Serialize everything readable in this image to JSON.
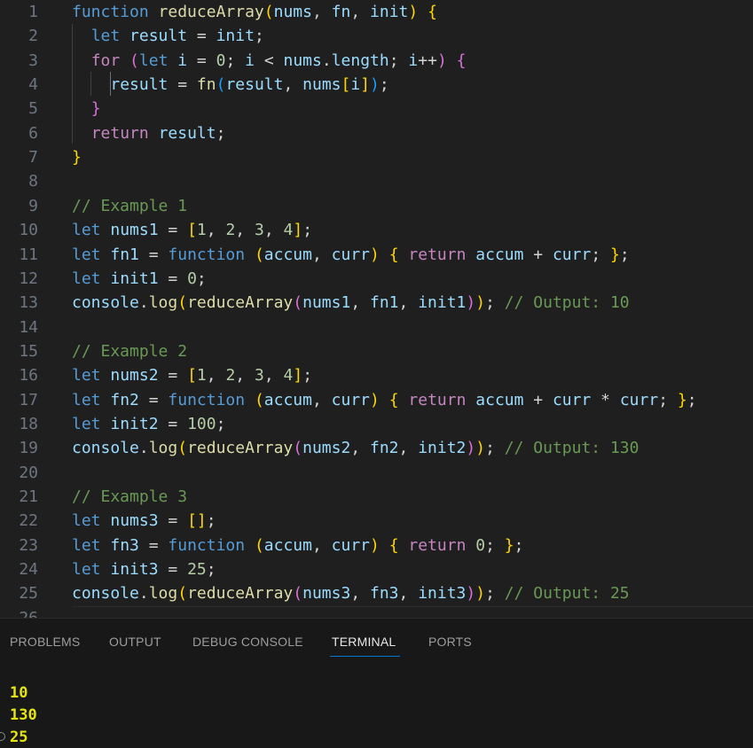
{
  "editor": {
    "lines": [
      {
        "num": "1",
        "tokens": [
          [
            "function",
            "#569cd6"
          ],
          [
            " ",
            "#cccccc"
          ],
          [
            "reduceArray",
            "#dcdcaa"
          ],
          [
            "(",
            "#ffd700"
          ],
          [
            "nums",
            "#9cdcfe"
          ],
          [
            ", ",
            "#cccccc"
          ],
          [
            "fn",
            "#9cdcfe"
          ],
          [
            ", ",
            "#cccccc"
          ],
          [
            "init",
            "#9cdcfe"
          ],
          [
            ")",
            "#ffd700"
          ],
          [
            " ",
            "#cccccc"
          ],
          [
            "{",
            "#ffd700"
          ]
        ]
      },
      {
        "num": "2",
        "tokens": [
          [
            "  ",
            "#cccccc"
          ],
          [
            "let",
            "#569cd6"
          ],
          [
            " ",
            "#cccccc"
          ],
          [
            "result",
            "#9cdcfe"
          ],
          [
            " = ",
            "#d4d4d4"
          ],
          [
            "init",
            "#9cdcfe"
          ],
          [
            ";",
            "#d4d4d4"
          ]
        ]
      },
      {
        "num": "3",
        "tokens": [
          [
            "  ",
            "#cccccc"
          ],
          [
            "for",
            "#c586c0"
          ],
          [
            " ",
            "#cccccc"
          ],
          [
            "(",
            "#da70d6"
          ],
          [
            "let",
            "#569cd6"
          ],
          [
            " ",
            "#cccccc"
          ],
          [
            "i",
            "#9cdcfe"
          ],
          [
            " = ",
            "#d4d4d4"
          ],
          [
            "0",
            "#b5cea8"
          ],
          [
            "; ",
            "#d4d4d4"
          ],
          [
            "i",
            "#9cdcfe"
          ],
          [
            " < ",
            "#d4d4d4"
          ],
          [
            "nums",
            "#9cdcfe"
          ],
          [
            ".",
            "#d4d4d4"
          ],
          [
            "length",
            "#9cdcfe"
          ],
          [
            "; ",
            "#d4d4d4"
          ],
          [
            "i",
            "#9cdcfe"
          ],
          [
            "++",
            "#d4d4d4"
          ],
          [
            ")",
            "#da70d6"
          ],
          [
            " ",
            "#cccccc"
          ],
          [
            "{",
            "#da70d6"
          ]
        ]
      },
      {
        "num": "4",
        "tokens": [
          [
            "    ",
            "#cccccc"
          ],
          [
            "result",
            "#9cdcfe"
          ],
          [
            " = ",
            "#d4d4d4"
          ],
          [
            "fn",
            "#dcdcaa"
          ],
          [
            "(",
            "#179fff"
          ],
          [
            "result",
            "#9cdcfe"
          ],
          [
            ", ",
            "#d4d4d4"
          ],
          [
            "nums",
            "#9cdcfe"
          ],
          [
            "[",
            "#ffd700"
          ],
          [
            "i",
            "#9cdcfe"
          ],
          [
            "]",
            "#ffd700"
          ],
          [
            ")",
            "#179fff"
          ],
          [
            ";",
            "#d4d4d4"
          ]
        ]
      },
      {
        "num": "5",
        "tokens": [
          [
            "  ",
            "#cccccc"
          ],
          [
            "}",
            "#da70d6"
          ]
        ]
      },
      {
        "num": "6",
        "tokens": [
          [
            "  ",
            "#cccccc"
          ],
          [
            "return",
            "#c586c0"
          ],
          [
            " ",
            "#cccccc"
          ],
          [
            "result",
            "#9cdcfe"
          ],
          [
            ";",
            "#d4d4d4"
          ]
        ]
      },
      {
        "num": "7",
        "tokens": [
          [
            "}",
            "#ffd700"
          ]
        ]
      },
      {
        "num": "8",
        "tokens": []
      },
      {
        "num": "9",
        "tokens": [
          [
            "// Example 1",
            "#6a9955"
          ]
        ]
      },
      {
        "num": "10",
        "tokens": [
          [
            "let",
            "#569cd6"
          ],
          [
            " ",
            "#cccccc"
          ],
          [
            "nums1",
            "#9cdcfe"
          ],
          [
            " = ",
            "#d4d4d4"
          ],
          [
            "[",
            "#ffd700"
          ],
          [
            "1",
            "#b5cea8"
          ],
          [
            ", ",
            "#d4d4d4"
          ],
          [
            "2",
            "#b5cea8"
          ],
          [
            ", ",
            "#d4d4d4"
          ],
          [
            "3",
            "#b5cea8"
          ],
          [
            ", ",
            "#d4d4d4"
          ],
          [
            "4",
            "#b5cea8"
          ],
          [
            "]",
            "#ffd700"
          ],
          [
            ";",
            "#d4d4d4"
          ]
        ]
      },
      {
        "num": "11",
        "tokens": [
          [
            "let",
            "#569cd6"
          ],
          [
            " ",
            "#cccccc"
          ],
          [
            "fn1",
            "#9cdcfe"
          ],
          [
            " = ",
            "#d4d4d4"
          ],
          [
            "function",
            "#569cd6"
          ],
          [
            " ",
            "#cccccc"
          ],
          [
            "(",
            "#ffd700"
          ],
          [
            "accum",
            "#9cdcfe"
          ],
          [
            ", ",
            "#d4d4d4"
          ],
          [
            "curr",
            "#9cdcfe"
          ],
          [
            ")",
            "#ffd700"
          ],
          [
            " ",
            "#cccccc"
          ],
          [
            "{",
            "#ffd700"
          ],
          [
            " ",
            "#cccccc"
          ],
          [
            "return",
            "#c586c0"
          ],
          [
            " ",
            "#cccccc"
          ],
          [
            "accum",
            "#9cdcfe"
          ],
          [
            " + ",
            "#d4d4d4"
          ],
          [
            "curr",
            "#9cdcfe"
          ],
          [
            "; ",
            "#d4d4d4"
          ],
          [
            "}",
            "#ffd700"
          ],
          [
            ";",
            "#d4d4d4"
          ]
        ]
      },
      {
        "num": "12",
        "tokens": [
          [
            "let",
            "#569cd6"
          ],
          [
            " ",
            "#cccccc"
          ],
          [
            "init1",
            "#9cdcfe"
          ],
          [
            " = ",
            "#d4d4d4"
          ],
          [
            "0",
            "#b5cea8"
          ],
          [
            ";",
            "#d4d4d4"
          ]
        ]
      },
      {
        "num": "13",
        "tokens": [
          [
            "console",
            "#9cdcfe"
          ],
          [
            ".",
            "#d4d4d4"
          ],
          [
            "log",
            "#dcdcaa"
          ],
          [
            "(",
            "#ffd700"
          ],
          [
            "reduceArray",
            "#dcdcaa"
          ],
          [
            "(",
            "#da70d6"
          ],
          [
            "nums1",
            "#9cdcfe"
          ],
          [
            ", ",
            "#d4d4d4"
          ],
          [
            "fn1",
            "#9cdcfe"
          ],
          [
            ", ",
            "#d4d4d4"
          ],
          [
            "init1",
            "#9cdcfe"
          ],
          [
            ")",
            "#da70d6"
          ],
          [
            ")",
            "#ffd700"
          ],
          [
            ";",
            "#d4d4d4"
          ],
          [
            " ",
            "#cccccc"
          ],
          [
            "// Output: 10",
            "#6a9955"
          ]
        ]
      },
      {
        "num": "14",
        "tokens": []
      },
      {
        "num": "15",
        "tokens": [
          [
            "// Example 2",
            "#6a9955"
          ]
        ]
      },
      {
        "num": "16",
        "tokens": [
          [
            "let",
            "#569cd6"
          ],
          [
            " ",
            "#cccccc"
          ],
          [
            "nums2",
            "#9cdcfe"
          ],
          [
            " = ",
            "#d4d4d4"
          ],
          [
            "[",
            "#ffd700"
          ],
          [
            "1",
            "#b5cea8"
          ],
          [
            ", ",
            "#d4d4d4"
          ],
          [
            "2",
            "#b5cea8"
          ],
          [
            ", ",
            "#d4d4d4"
          ],
          [
            "3",
            "#b5cea8"
          ],
          [
            ", ",
            "#d4d4d4"
          ],
          [
            "4",
            "#b5cea8"
          ],
          [
            "]",
            "#ffd700"
          ],
          [
            ";",
            "#d4d4d4"
          ]
        ]
      },
      {
        "num": "17",
        "tokens": [
          [
            "let",
            "#569cd6"
          ],
          [
            " ",
            "#cccccc"
          ],
          [
            "fn2",
            "#9cdcfe"
          ],
          [
            " = ",
            "#d4d4d4"
          ],
          [
            "function",
            "#569cd6"
          ],
          [
            " ",
            "#cccccc"
          ],
          [
            "(",
            "#ffd700"
          ],
          [
            "accum",
            "#9cdcfe"
          ],
          [
            ", ",
            "#d4d4d4"
          ],
          [
            "curr",
            "#9cdcfe"
          ],
          [
            ")",
            "#ffd700"
          ],
          [
            " ",
            "#cccccc"
          ],
          [
            "{",
            "#ffd700"
          ],
          [
            " ",
            "#cccccc"
          ],
          [
            "return",
            "#c586c0"
          ],
          [
            " ",
            "#cccccc"
          ],
          [
            "accum",
            "#9cdcfe"
          ],
          [
            " + ",
            "#d4d4d4"
          ],
          [
            "curr",
            "#9cdcfe"
          ],
          [
            " * ",
            "#d4d4d4"
          ],
          [
            "curr",
            "#9cdcfe"
          ],
          [
            "; ",
            "#d4d4d4"
          ],
          [
            "}",
            "#ffd700"
          ],
          [
            ";",
            "#d4d4d4"
          ]
        ]
      },
      {
        "num": "18",
        "tokens": [
          [
            "let",
            "#569cd6"
          ],
          [
            " ",
            "#cccccc"
          ],
          [
            "init2",
            "#9cdcfe"
          ],
          [
            " = ",
            "#d4d4d4"
          ],
          [
            "100",
            "#b5cea8"
          ],
          [
            ";",
            "#d4d4d4"
          ]
        ]
      },
      {
        "num": "19",
        "tokens": [
          [
            "console",
            "#9cdcfe"
          ],
          [
            ".",
            "#d4d4d4"
          ],
          [
            "log",
            "#dcdcaa"
          ],
          [
            "(",
            "#ffd700"
          ],
          [
            "reduceArray",
            "#dcdcaa"
          ],
          [
            "(",
            "#da70d6"
          ],
          [
            "nums2",
            "#9cdcfe"
          ],
          [
            ", ",
            "#d4d4d4"
          ],
          [
            "fn2",
            "#9cdcfe"
          ],
          [
            ", ",
            "#d4d4d4"
          ],
          [
            "init2",
            "#9cdcfe"
          ],
          [
            ")",
            "#da70d6"
          ],
          [
            ")",
            "#ffd700"
          ],
          [
            ";",
            "#d4d4d4"
          ],
          [
            " ",
            "#cccccc"
          ],
          [
            "// Output: 130",
            "#6a9955"
          ]
        ]
      },
      {
        "num": "20",
        "tokens": []
      },
      {
        "num": "21",
        "tokens": [
          [
            "// Example 3",
            "#6a9955"
          ]
        ]
      },
      {
        "num": "22",
        "tokens": [
          [
            "let",
            "#569cd6"
          ],
          [
            " ",
            "#cccccc"
          ],
          [
            "nums3",
            "#9cdcfe"
          ],
          [
            " = ",
            "#d4d4d4"
          ],
          [
            "[",
            "#ffd700"
          ],
          [
            "]",
            "#ffd700"
          ],
          [
            ";",
            "#d4d4d4"
          ]
        ]
      },
      {
        "num": "23",
        "tokens": [
          [
            "let",
            "#569cd6"
          ],
          [
            " ",
            "#cccccc"
          ],
          [
            "fn3",
            "#9cdcfe"
          ],
          [
            " = ",
            "#d4d4d4"
          ],
          [
            "function",
            "#569cd6"
          ],
          [
            " ",
            "#cccccc"
          ],
          [
            "(",
            "#ffd700"
          ],
          [
            "accum",
            "#9cdcfe"
          ],
          [
            ", ",
            "#d4d4d4"
          ],
          [
            "curr",
            "#9cdcfe"
          ],
          [
            ")",
            "#ffd700"
          ],
          [
            " ",
            "#cccccc"
          ],
          [
            "{",
            "#ffd700"
          ],
          [
            " ",
            "#cccccc"
          ],
          [
            "return",
            "#c586c0"
          ],
          [
            " ",
            "#cccccc"
          ],
          [
            "0",
            "#b5cea8"
          ],
          [
            "; ",
            "#d4d4d4"
          ],
          [
            "}",
            "#ffd700"
          ],
          [
            ";",
            "#d4d4d4"
          ]
        ]
      },
      {
        "num": "24",
        "tokens": [
          [
            "let",
            "#569cd6"
          ],
          [
            " ",
            "#cccccc"
          ],
          [
            "init3",
            "#9cdcfe"
          ],
          [
            " = ",
            "#d4d4d4"
          ],
          [
            "25",
            "#b5cea8"
          ],
          [
            ";",
            "#d4d4d4"
          ]
        ]
      },
      {
        "num": "25",
        "tokens": [
          [
            "console",
            "#9cdcfe"
          ],
          [
            ".",
            "#d4d4d4"
          ],
          [
            "log",
            "#dcdcaa"
          ],
          [
            "(",
            "#ffd700"
          ],
          [
            "reduceArray",
            "#dcdcaa"
          ],
          [
            "(",
            "#da70d6"
          ],
          [
            "nums3",
            "#9cdcfe"
          ],
          [
            ", ",
            "#d4d4d4"
          ],
          [
            "fn3",
            "#9cdcfe"
          ],
          [
            ", ",
            "#d4d4d4"
          ],
          [
            "init3",
            "#9cdcfe"
          ],
          [
            ")",
            "#da70d6"
          ],
          [
            ")",
            "#ffd700"
          ],
          [
            ";",
            "#d4d4d4"
          ],
          [
            " ",
            "#cccccc"
          ],
          [
            "// Output: 25",
            "#6a9955"
          ]
        ]
      },
      {
        "num": "26",
        "tokens": []
      }
    ]
  },
  "panel": {
    "tabs": [
      "PROBLEMS",
      "OUTPUT",
      "DEBUG CONSOLE",
      "TERMINAL",
      "PORTS"
    ],
    "active_tab": "TERMINAL"
  },
  "terminal": {
    "output": [
      "10",
      "130",
      "25"
    ]
  }
}
